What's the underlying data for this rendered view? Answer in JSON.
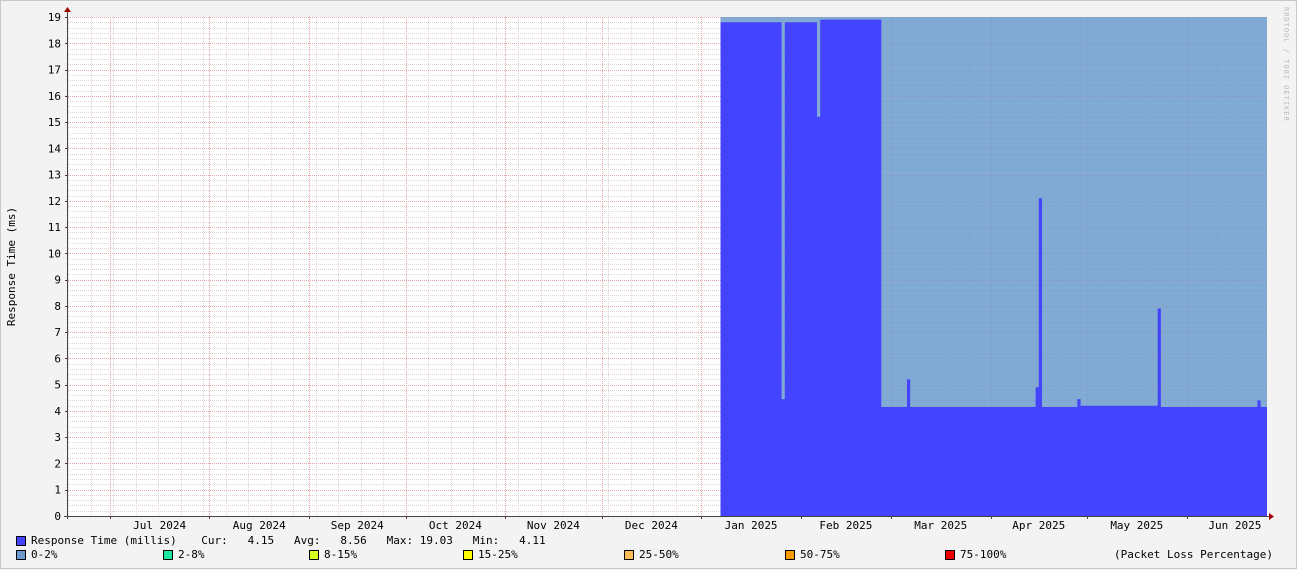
{
  "chart_data": {
    "type": "area",
    "ylabel": "Response Time (ms)",
    "ylim": [
      0,
      19
    ],
    "y_ticks": [
      "0",
      "1",
      "2",
      "3",
      "4",
      "5",
      "6",
      "7",
      "8",
      "9",
      "10",
      "11",
      "12",
      "13",
      "14",
      "15",
      "16",
      "17",
      "18",
      "19"
    ],
    "x_start": "2024-06-18",
    "x_end": "2025-06-26",
    "month_ticks": [
      {
        "label": "Jul 2024",
        "date": "2024-07-01"
      },
      {
        "label": "Aug 2024",
        "date": "2024-08-01"
      },
      {
        "label": "Sep 2024",
        "date": "2024-09-01"
      },
      {
        "label": "Oct 2024",
        "date": "2024-10-01"
      },
      {
        "label": "Nov 2024",
        "date": "2024-11-01"
      },
      {
        "label": "Dec 2024",
        "date": "2024-12-01"
      },
      {
        "label": "Jan 2025",
        "date": "2025-01-01"
      },
      {
        "label": "Feb 2025",
        "date": "2025-02-01"
      },
      {
        "label": "Mar 2025",
        "date": "2025-03-01"
      },
      {
        "label": "Apr 2025",
        "date": "2025-04-01"
      },
      {
        "label": "May 2025",
        "date": "2025-05-01"
      },
      {
        "label": "Jun 2025",
        "date": "2025-06-01"
      }
    ],
    "loss_band": {
      "start": "2025-01-07",
      "end": "2025-06-26",
      "color": "#6b9bcd",
      "legend": "0-2%"
    },
    "series": [
      {
        "name": "Response Time (millis)",
        "color": "#4444ff",
        "points": [
          {
            "x": "2025-01-07",
            "y": 18.8
          },
          {
            "x": "2025-01-26",
            "y": 18.8
          },
          {
            "x": "2025-01-26",
            "y": 4.45
          },
          {
            "x": "2025-01-27",
            "y": 4.45
          },
          {
            "x": "2025-01-27",
            "y": 18.8
          },
          {
            "x": "2025-02-06",
            "y": 18.8
          },
          {
            "x": "2025-02-06",
            "y": 15.2
          },
          {
            "x": "2025-02-07",
            "y": 15.2
          },
          {
            "x": "2025-02-07",
            "y": 18.9
          },
          {
            "x": "2025-02-26",
            "y": 18.9
          },
          {
            "x": "2025-02-26",
            "y": 4.15
          },
          {
            "x": "2025-03-06",
            "y": 4.15
          },
          {
            "x": "2025-03-06",
            "y": 5.2
          },
          {
            "x": "2025-03-07",
            "y": 5.2
          },
          {
            "x": "2025-03-07",
            "y": 4.15
          },
          {
            "x": "2025-04-15",
            "y": 4.15
          },
          {
            "x": "2025-04-15",
            "y": 4.9
          },
          {
            "x": "2025-04-16",
            "y": 4.9
          },
          {
            "x": "2025-04-16",
            "y": 12.1
          },
          {
            "x": "2025-04-17",
            "y": 12.1
          },
          {
            "x": "2025-04-17",
            "y": 4.15
          },
          {
            "x": "2025-04-28",
            "y": 4.15
          },
          {
            "x": "2025-04-28",
            "y": 4.45
          },
          {
            "x": "2025-04-29",
            "y": 4.45
          },
          {
            "x": "2025-04-29",
            "y": 4.2
          },
          {
            "x": "2025-05-23",
            "y": 4.2
          },
          {
            "x": "2025-05-23",
            "y": 7.9
          },
          {
            "x": "2025-05-24",
            "y": 7.9
          },
          {
            "x": "2025-05-24",
            "y": 4.15
          },
          {
            "x": "2025-06-23",
            "y": 4.15
          },
          {
            "x": "2025-06-23",
            "y": 4.4
          },
          {
            "x": "2025-06-24",
            "y": 4.4
          },
          {
            "x": "2025-06-24",
            "y": 4.15
          },
          {
            "x": "2025-06-26",
            "y": 4.15
          }
        ]
      }
    ],
    "grid": true,
    "watermark": "RRDTOOL / TOBI OETIKER"
  },
  "legend": {
    "series_label": "Response Time (millis)",
    "series_color": "#4444ff",
    "stats": "  Cur:   4.15   Avg:   8.56   Max: 19.03   Min:   4.11",
    "loss_items": [
      {
        "label": "0-2%",
        "color": "#6b9bcd"
      },
      {
        "label": "2-8%",
        "color": "#1ce6a0"
      },
      {
        "label": "8-15%",
        "color": "#d2ff1c"
      },
      {
        "label": "15-25%",
        "color": "#ffff00"
      },
      {
        "label": "25-50%",
        "color": "#ffbb55"
      },
      {
        "label": "50-75%",
        "color": "#ff9900"
      },
      {
        "label": "75-100%",
        "color": "#ee0000"
      }
    ],
    "loss_note": "(Packet Loss Percentage)"
  }
}
